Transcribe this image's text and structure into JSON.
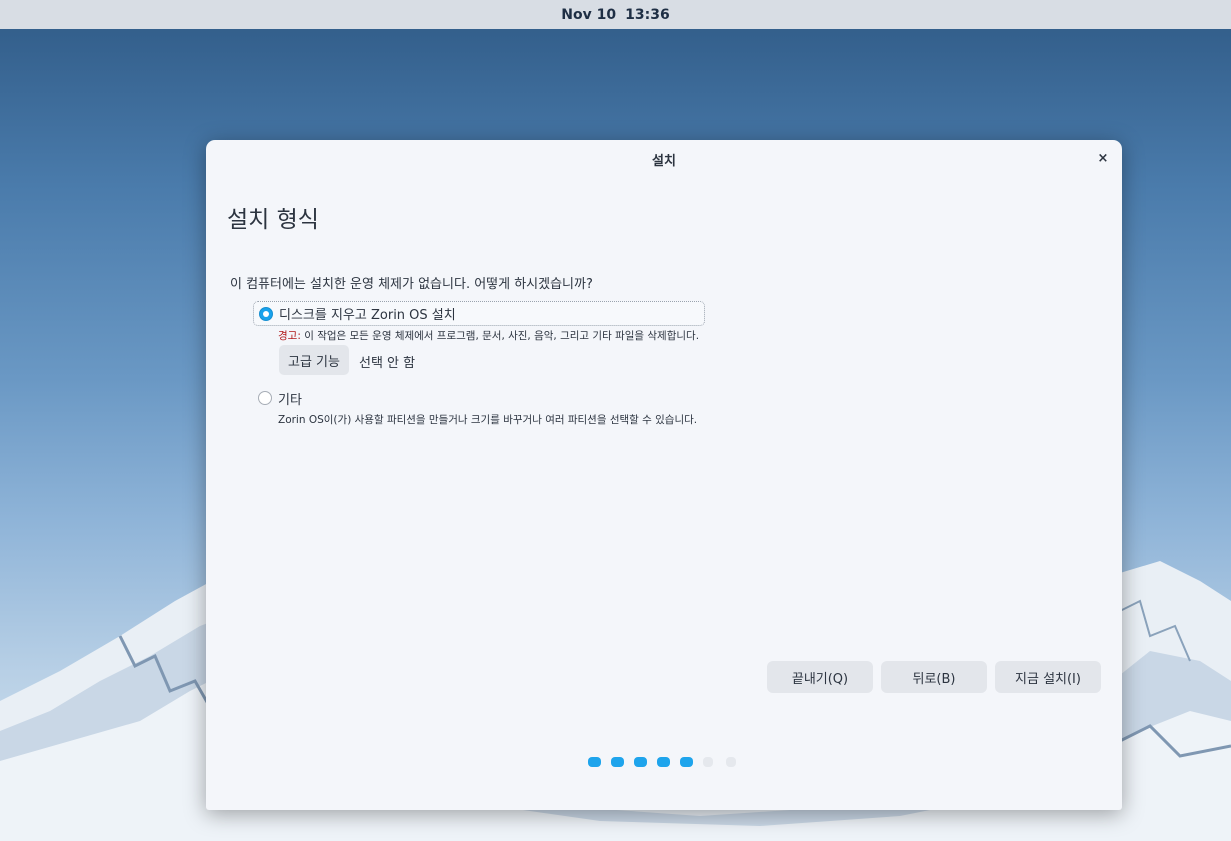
{
  "topbar": {
    "date": "Nov 10",
    "time": "13:36"
  },
  "window": {
    "title": "설치",
    "close_icon": "×"
  },
  "page": {
    "heading": "설치 형식",
    "question": "이 컴퓨터에는 설치한 운영 체제가 없습니다. 어떻게 하시겠습니까?"
  },
  "options": {
    "erase": {
      "label": "디스크를 지우고 Zorin OS 설치",
      "selected": true,
      "warning_prefix": "경고:",
      "warning_text": " 이 작업은 모든 운영 체제에서 프로그램, 문서, 사진, 음악, 그리고 기타 파일을 삭제합니다.",
      "advanced_button": "고급 기능",
      "advanced_status": "선택 안 함"
    },
    "other": {
      "label": "기타",
      "selected": false,
      "description": "Zorin OS이(가) 사용할 파티션을 만들거나 크기를 바꾸거나 여러 파티션을 선택할 수 있습니다."
    }
  },
  "buttons": {
    "quit": "끝내기(Q)",
    "back": "뒤로(B)",
    "install": "지금 설치(I)"
  },
  "progress": {
    "total_steps": 7,
    "completed_steps": 5
  },
  "colors": {
    "accent": "#18a2ec",
    "warning": "#b01818",
    "window_bg": "#f4f6fa",
    "button_bg": "#e3e6eb"
  }
}
